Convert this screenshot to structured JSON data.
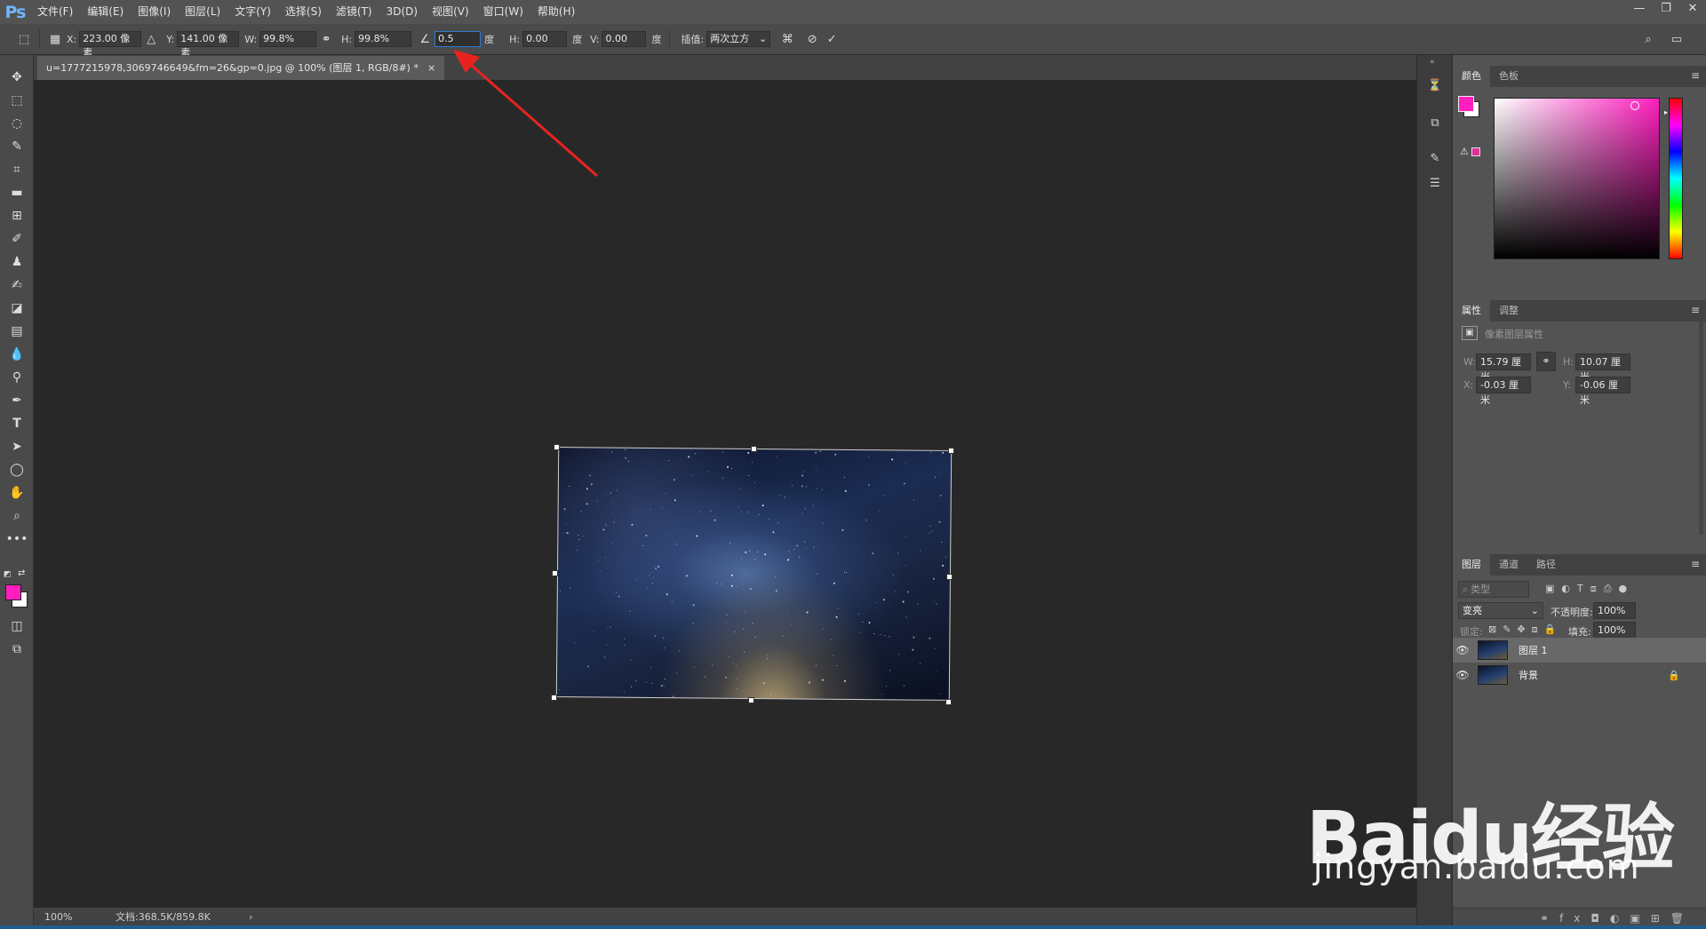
{
  "menubar": {
    "logo": "Ps",
    "items": [
      "文件(F)",
      "编辑(E)",
      "图像(I)",
      "图层(L)",
      "文字(Y)",
      "选择(S)",
      "滤镜(T)",
      "3D(D)",
      "视图(V)",
      "窗口(W)",
      "帮助(H)"
    ]
  },
  "options": {
    "x_label": "X:",
    "x_value": "223.00 像素",
    "y_label": "Y:",
    "y_value": "141.00 像素",
    "w_label": "W:",
    "w_value": "99.8%",
    "h_label": "H:",
    "h_value": "99.8%",
    "angle_value": "0.5",
    "angle_unit": "度",
    "hskew_label": "H:",
    "hskew_value": "0.00",
    "hskew_unit": "度",
    "vskew_label": "V:",
    "vskew_value": "0.00",
    "vskew_unit": "度",
    "interp_label": "插值:",
    "interp_value": "两次立方"
  },
  "document": {
    "tab_title": "u=1777215978,3069746649&fm=26&gp=0.jpg @ 100% (图层 1, RGB/8#) *",
    "close": "×"
  },
  "status": {
    "zoom": "100%",
    "doc_info": "文档:368.5K/859.8K",
    "arrow": "›"
  },
  "panels": {
    "color_tabs": [
      "颜色",
      "色板"
    ],
    "props_tabs": [
      "属性",
      "调整"
    ],
    "props_title": "像素图层属性",
    "w_label": "W:",
    "w_value": "15.79 厘米",
    "h_label": "H:",
    "h_value": "10.07 厘米",
    "x_label": "X:",
    "x_value": "-0.03 厘米",
    "y_label": "Y:",
    "y_value": "-0.06 厘米",
    "layers_tabs": [
      "图层",
      "通道",
      "路径"
    ],
    "kind_placeholder": "类型",
    "blend_mode": "变亮",
    "opacity_label": "不透明度:",
    "opacity_value": "100%",
    "lock_label": "锁定:",
    "fill_label": "填充:",
    "fill_value": "100%",
    "layers": [
      {
        "name": "图层 1"
      },
      {
        "name": "背景"
      }
    ]
  },
  "colors": {
    "foreground": "#ff1fbf",
    "background": "#ffffff",
    "annotation_arrow": "#e8231f"
  },
  "watermark": {
    "main": "Baidu经验",
    "sub": "jingyan.baidu.com"
  }
}
